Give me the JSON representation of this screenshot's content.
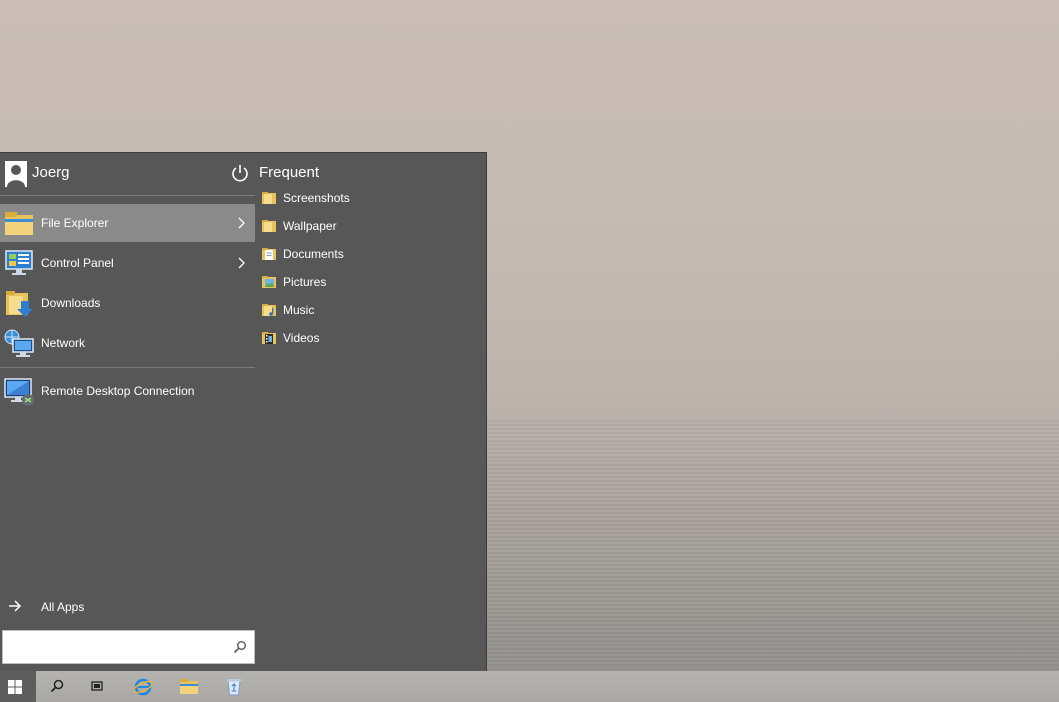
{
  "start_menu": {
    "user": {
      "name": "Joerg"
    },
    "items": [
      {
        "label": "File Explorer",
        "has_submenu": true,
        "active": true
      },
      {
        "label": "Control Panel",
        "has_submenu": true
      },
      {
        "label": "Downloads"
      },
      {
        "label": "Network"
      }
    ],
    "pinned": [
      {
        "label": "Remote Desktop Connection"
      }
    ],
    "all_apps_label": "All Apps",
    "search": {
      "value": "",
      "placeholder": ""
    },
    "frequent": {
      "title": "Frequent",
      "items": [
        {
          "label": "Screenshots",
          "icon": "folder-icon"
        },
        {
          "label": "Wallpaper",
          "icon": "folder-icon"
        },
        {
          "label": "Documents",
          "icon": "documents-folder-icon"
        },
        {
          "label": "Pictures",
          "icon": "pictures-folder-icon"
        },
        {
          "label": "Music",
          "icon": "music-folder-icon"
        },
        {
          "label": "Videos",
          "icon": "videos-folder-icon"
        }
      ]
    }
  },
  "taskbar": {
    "buttons": [
      "start-windows-icon",
      "search-icon",
      "task-view-icon",
      "internet-explorer-icon",
      "file-explorer-icon",
      "recycle-bin-icon"
    ]
  },
  "colors": {
    "menu_bg": "#575757",
    "menu_active": "#8a8a8a",
    "taskbar_bg": "#b0aeab",
    "folder_yellow": "#e8c25a"
  }
}
